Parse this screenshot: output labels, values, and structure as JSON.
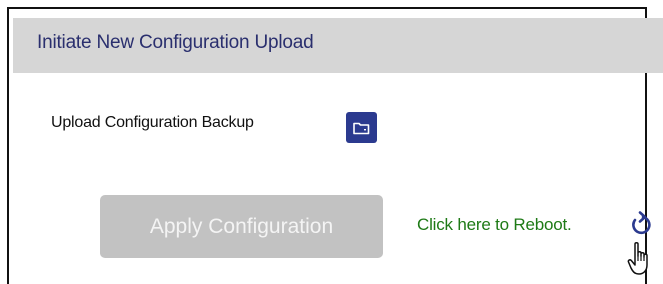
{
  "panel": {
    "title": "Initiate New Configuration Upload"
  },
  "upload": {
    "label": "Upload Configuration Backup",
    "button_icon": "folder-icon"
  },
  "apply": {
    "label": "Apply Configuration",
    "disabled": true
  },
  "reboot": {
    "link_text": "Click here to Reboot.",
    "icon": "reboot-icon"
  },
  "colors": {
    "header_bg": "#d6d6d6",
    "title_color": "#2a2f6e",
    "upload_button_bg": "#2b3a8f",
    "apply_button_bg": "#c2c2c2",
    "link_color": "#1e7a16"
  }
}
